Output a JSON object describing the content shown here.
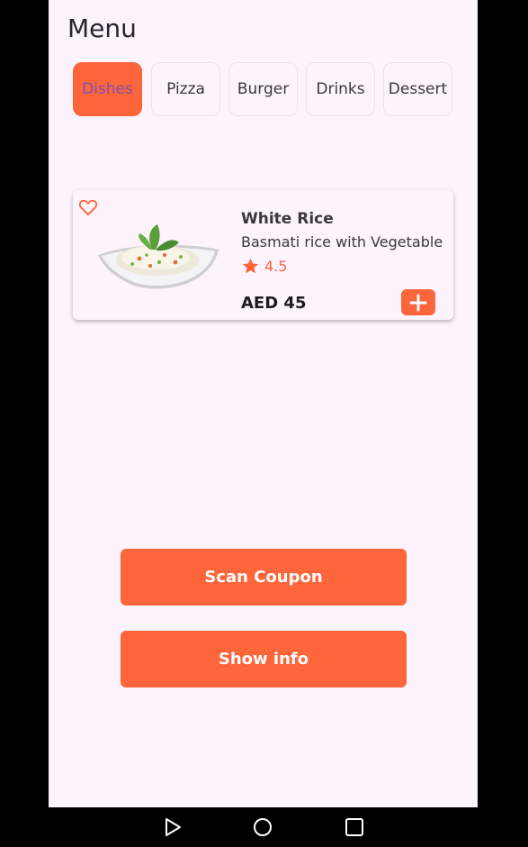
{
  "header": {
    "title": "Menu"
  },
  "tabs": [
    {
      "label": "Dishes",
      "active": true
    },
    {
      "label": "Pizza",
      "active": false
    },
    {
      "label": "Burger",
      "active": false
    },
    {
      "label": "Drinks",
      "active": false
    },
    {
      "label": "Dessert",
      "active": false
    }
  ],
  "card": {
    "name": "White Rice",
    "description": "Basmati rice with Vegetable",
    "rating": "4.5",
    "price": "AED 45",
    "icons": {
      "favorite": "heart-outline-icon",
      "rating": "star-icon",
      "add": "plus-icon"
    }
  },
  "actions": {
    "scan_coupon": "Scan Coupon",
    "show_info": "Show info"
  },
  "system_nav": {
    "icons": [
      "back-icon",
      "home-icon",
      "recents-icon"
    ]
  },
  "colors": {
    "accent": "#fd653b",
    "background": "#fdf3fc",
    "active_tab_text": "#7d4fb0",
    "text": "#3b3640"
  }
}
